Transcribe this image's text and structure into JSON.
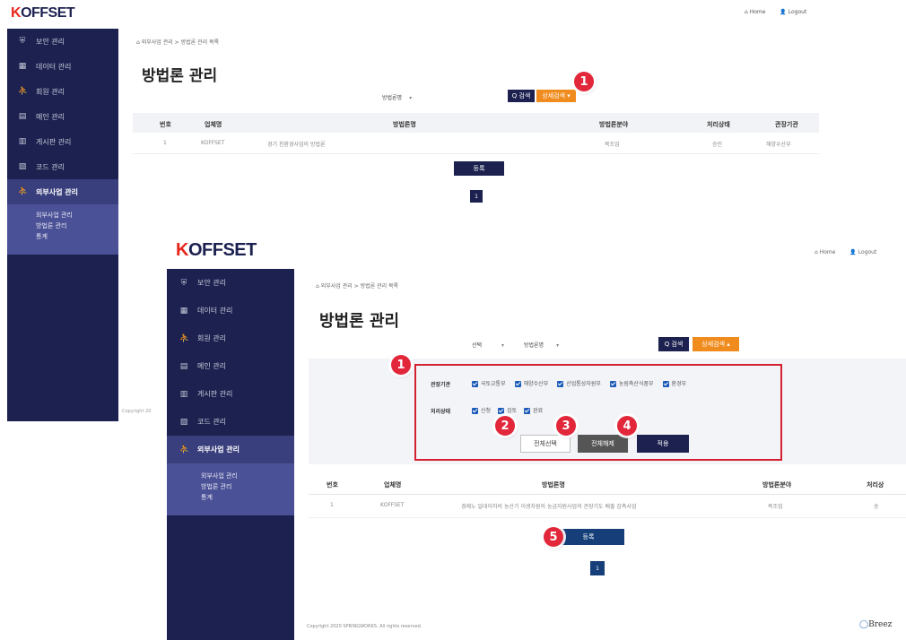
{
  "back": {
    "logo": "KOFFSET",
    "header": {
      "home": "Home",
      "logout": "Logout"
    },
    "sidebar": [
      {
        "label": "보안 관리",
        "icon": "shield-icon"
      },
      {
        "label": "데이터 관리",
        "icon": "database-icon"
      },
      {
        "label": "회원 관리",
        "icon": "users-icon"
      },
      {
        "label": "메인 관리",
        "icon": "layout-icon"
      },
      {
        "label": "게시판 관리",
        "icon": "board-icon"
      },
      {
        "label": "코드 관리",
        "icon": "code-icon"
      },
      {
        "label": "외부사업 관리",
        "icon": "users-icon",
        "active": true
      }
    ],
    "submenu": [
      "외부사업 관리",
      "방법론 관리",
      "통계"
    ],
    "breadcrumb": "외부사업 관리 > 방법론 관리 목록",
    "title": "방법론 관리",
    "filter_label": "방법론명",
    "search_btn": "Q 검색",
    "detail_btn": "상세검색 ▾",
    "table_headers": [
      "번호",
      "업체명",
      "방법론명",
      "방법론분야",
      "처리상태",
      "관장기관"
    ],
    "row": [
      "1",
      "KOFFSET",
      "경기 친환경사업의 방법론",
      "목조업",
      "승인",
      "해양수산부"
    ],
    "register_btn": "등록",
    "page": "1",
    "copyright": "Copyright 20"
  },
  "front": {
    "logo": "KOFFSET",
    "header": {
      "home": "Home",
      "logout": "Logout"
    },
    "sidebar": [
      {
        "label": "보안 관리",
        "icon": "shield-icon"
      },
      {
        "label": "데이터 관리",
        "icon": "database-icon"
      },
      {
        "label": "회원 관리",
        "icon": "users-icon"
      },
      {
        "label": "메인 관리",
        "icon": "layout-icon"
      },
      {
        "label": "게시판 관리",
        "icon": "board-icon"
      },
      {
        "label": "코드 관리",
        "icon": "code-icon"
      },
      {
        "label": "외부사업 관리",
        "icon": "users-icon",
        "active": true
      }
    ],
    "submenu": [
      "외부사업 관리",
      "방법론 관리",
      "통계"
    ],
    "breadcrumb": "외부사업 관리 > 방법론 관리 목록",
    "title": "방법론 관리",
    "select1": "선택",
    "select2": "방법론명",
    "search_btn": "Q 검색",
    "detail_btn": "상세검색 ▴",
    "agency_label": "관장기관",
    "agencies": [
      "국토교통부",
      "해양수산부",
      "산업통상자원부",
      "농림축산식품부",
      "환경부"
    ],
    "status_label": "처리상태",
    "statuses": [
      "신청",
      "검토",
      "완료"
    ],
    "btn_select_all": "전체선택",
    "btn_clear_all": "전체해제",
    "btn_apply": "적용",
    "table_headers": [
      "번호",
      "업체명",
      "방법론명",
      "방법론분야",
      "처리상"
    ],
    "row": [
      "1",
      "KOFFSET",
      "경제노 일대이하의 농산기 이생자원의 농금자원사업의 관장기도 배출 감축사업",
      "목조업",
      "승"
    ],
    "register_btn": "등록",
    "page": "1",
    "copyright": "Copyright 2020 SPRINGWORKS. All rights reserved.",
    "brand": "Breez"
  },
  "callouts": [
    "1",
    "1",
    "2",
    "3",
    "4",
    "5"
  ],
  "colors": {
    "navy": "#1c2150",
    "orange": "#f08c1e",
    "red_box": "#d42031",
    "callout": "#e2273b"
  }
}
